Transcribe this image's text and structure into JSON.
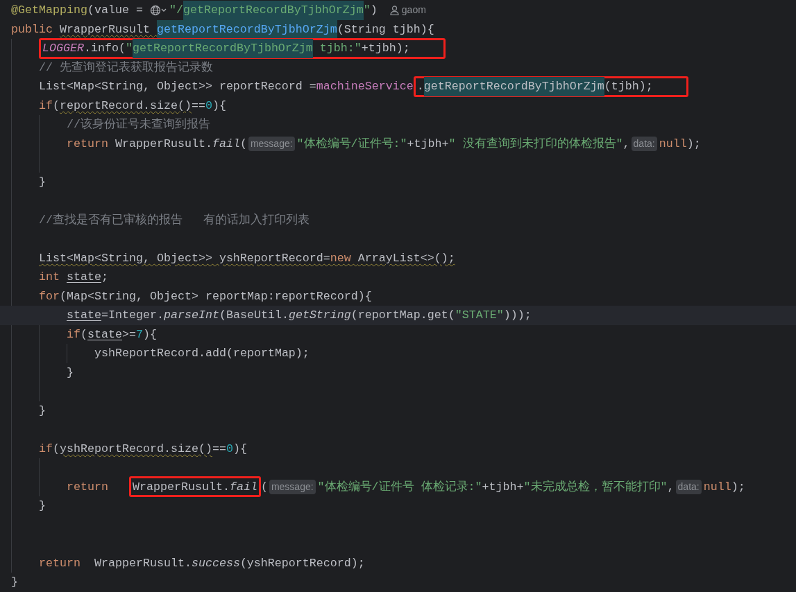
{
  "editor": {
    "lines": [
      {
        "tokens": [
          {
            "kind": "ann",
            "text": "@GetMapping"
          },
          {
            "kind": "plain",
            "text": "(value = "
          },
          {
            "kind": "globe"
          },
          {
            "kind": "str",
            "text": "\"/"
          },
          {
            "kind": "str",
            "text": "getReportRecordByTjbhOrZjm",
            "highlight": true
          },
          {
            "kind": "str",
            "text": "\""
          },
          {
            "kind": "plain",
            "text": ")"
          },
          {
            "kind": "author",
            "text": "gaom"
          }
        ]
      },
      {
        "tokens": [
          {
            "kind": "kw",
            "text": "public "
          },
          {
            "kind": "plain",
            "text": "WrapperRusult ",
            "warning": true
          },
          {
            "kind": "decl",
            "text": "getReportRecordByTjbhOrZjm",
            "highlight": true
          },
          {
            "kind": "plain",
            "text": "(String tjbh){"
          }
        ],
        "children": [
          {
            "tokens": [
              {
                "kind": "callout",
                "tokens": [
                  {
                    "kind": "field",
                    "text": "LOGGER"
                  },
                  {
                    "kind": "plain",
                    "text": ".info("
                  },
                  {
                    "kind": "str",
                    "text": "\""
                  },
                  {
                    "kind": "str",
                    "text": "getReportRecordByTjbhOrZjm",
                    "highlight": true
                  },
                  {
                    "kind": "str",
                    "text": " tjbh:\""
                  },
                  {
                    "kind": "plain",
                    "text": "+tjbh);"
                  }
                ]
              }
            ]
          },
          {
            "tokens": [
              {
                "kind": "comment",
                "text": "// 先查询登记表获取报告记录数"
              }
            ]
          },
          {
            "tokens": [
              {
                "kind": "plain",
                "text": "List<Map<String, Object>> reportRecord ="
              },
              {
                "kind": "member",
                "text": "machineService"
              },
              {
                "kind": "callout",
                "tokens": [
                  {
                    "kind": "plain",
                    "text": "."
                  },
                  {
                    "kind": "plain",
                    "text": "getReportRecordByTjbhOrZjm",
                    "highlight": true
                  },
                  {
                    "kind": "plain",
                    "text": "(tjbh);"
                  }
                ]
              }
            ]
          },
          {
            "tokens": [
              {
                "kind": "kw",
                "text": "if"
              },
              {
                "kind": "plain",
                "text": "("
              },
              {
                "kind": "plain",
                "text": "reportRecord.size()",
                "warning": true
              },
              {
                "kind": "plain",
                "text": "=="
              },
              {
                "kind": "num",
                "text": "0"
              },
              {
                "kind": "plain",
                "text": "){"
              }
            ],
            "children": [
              {
                "tokens": [
                  {
                    "kind": "comment",
                    "text": "//该身份证号未查询到报告"
                  }
                ]
              },
              {
                "tokens": [
                  {
                    "kind": "kw",
                    "text": "return "
                  },
                  {
                    "kind": "plain",
                    "text": "WrapperRusult."
                  },
                  {
                    "kind": "static",
                    "text": "fail"
                  },
                  {
                    "kind": "plain",
                    "text": "("
                  },
                  {
                    "kind": "hint",
                    "text": "message:"
                  },
                  {
                    "kind": "str",
                    "text": "\"体检编号/证件号:\""
                  },
                  {
                    "kind": "plain",
                    "text": "+tjbh+"
                  },
                  {
                    "kind": "str",
                    "text": "\" 没有查询到未打印的体检报告\""
                  },
                  {
                    "kind": "plain",
                    "text": ","
                  },
                  {
                    "kind": "hint",
                    "text": "data:"
                  },
                  {
                    "kind": "kw",
                    "text": "null"
                  },
                  {
                    "kind": "plain",
                    "text": ");"
                  }
                ]
              },
              {
                "kind": "blank"
              }
            ]
          },
          {
            "tokens": [
              {
                "kind": "plain",
                "text": "}"
              }
            ]
          },
          {
            "kind": "blank"
          },
          {
            "tokens": [
              {
                "kind": "comment",
                "text": "//查找是否有已审核的报告   有的话加入打印列表"
              }
            ]
          },
          {
            "kind": "blank"
          },
          {
            "tokens": [
              {
                "kind": "plain",
                "text": "List<Map<String, Object>> yshReportRecord=",
                "warning": true
              },
              {
                "kind": "kw",
                "text": "new ",
                "warning": true
              },
              {
                "kind": "plain",
                "text": "ArrayList<>();",
                "warning": true
              }
            ]
          },
          {
            "tokens": [
              {
                "kind": "kw",
                "text": "int "
              },
              {
                "kind": "plain",
                "text": "state",
                "reassigned": true
              },
              {
                "kind": "plain",
                "text": ";"
              }
            ]
          },
          {
            "tokens": [
              {
                "kind": "kw",
                "text": "for"
              },
              {
                "kind": "plain",
                "text": "(Map<String, Object> reportMap:reportRecord){"
              }
            ],
            "children": [
              {
                "current": true,
                "tokens": [
                  {
                    "kind": "plain",
                    "text": "state",
                    "reassigned": true
                  },
                  {
                    "kind": "plain",
                    "text": "=Integer."
                  },
                  {
                    "kind": "static",
                    "text": "parseInt"
                  },
                  {
                    "kind": "plain",
                    "text": "(BaseUtil."
                  },
                  {
                    "kind": "static",
                    "text": "getString"
                  },
                  {
                    "kind": "plain",
                    "text": "(reportMap.get("
                  },
                  {
                    "kind": "str",
                    "text": "\"STATE\""
                  },
                  {
                    "kind": "plain",
                    "text": ")));"
                  }
                ]
              },
              {
                "tokens": [
                  {
                    "kind": "kw",
                    "text": "if"
                  },
                  {
                    "kind": "plain",
                    "text": "("
                  },
                  {
                    "kind": "plain",
                    "text": "state",
                    "reassigned": true
                  },
                  {
                    "kind": "plain",
                    "text": ">="
                  },
                  {
                    "kind": "num",
                    "text": "7"
                  },
                  {
                    "kind": "plain",
                    "text": "){"
                  }
                ],
                "children": [
                  {
                    "tokens": [
                      {
                        "kind": "plain",
                        "text": "yshReportRecord.add(reportMap);"
                      }
                    ]
                  }
                ]
              },
              {
                "tokens": [
                  {
                    "kind": "plain",
                    "text": "}"
                  }
                ]
              },
              {
                "kind": "blank"
              }
            ]
          },
          {
            "tokens": [
              {
                "kind": "plain",
                "text": "}"
              }
            ]
          },
          {
            "kind": "blank"
          },
          {
            "tokens": [
              {
                "kind": "kw",
                "text": "if"
              },
              {
                "kind": "plain",
                "text": "("
              },
              {
                "kind": "plain",
                "text": "yshReportRecord.size()",
                "warning": true
              },
              {
                "kind": "plain",
                "text": "=="
              },
              {
                "kind": "num",
                "text": "0"
              },
              {
                "kind": "plain",
                "text": "){"
              }
            ],
            "children": [
              {
                "kind": "blank"
              },
              {
                "tokens": [
                  {
                    "kind": "kw",
                    "text": "return   "
                  },
                  {
                    "kind": "callout",
                    "tokens": [
                      {
                        "kind": "plain",
                        "text": "WrapperRusult."
                      },
                      {
                        "kind": "static",
                        "text": "fail"
                      }
                    ]
                  },
                  {
                    "kind": "plain",
                    "text": "("
                  },
                  {
                    "kind": "hint",
                    "text": "message:"
                  },
                  {
                    "kind": "str",
                    "text": "\"体检编号/证件号 体检记录:\""
                  },
                  {
                    "kind": "plain",
                    "text": "+tjbh+"
                  },
                  {
                    "kind": "str",
                    "text": "\"未完成总检，暂不能打印\""
                  },
                  {
                    "kind": "plain",
                    "text": ","
                  },
                  {
                    "kind": "hint",
                    "text": "data:"
                  },
                  {
                    "kind": "kw",
                    "text": "null"
                  },
                  {
                    "kind": "plain",
                    "text": ");"
                  }
                ]
              }
            ]
          },
          {
            "tokens": [
              {
                "kind": "plain",
                "text": "}"
              }
            ]
          },
          {
            "kind": "blank"
          },
          {
            "kind": "blank"
          },
          {
            "tokens": [
              {
                "kind": "kw",
                "text": "return  "
              },
              {
                "kind": "plain",
                "text": "WrapperRusult."
              },
              {
                "kind": "static",
                "text": "success"
              },
              {
                "kind": "plain",
                "text": "(yshReportRecord);"
              }
            ]
          }
        ]
      },
      {
        "tokens": [
          {
            "kind": "plain",
            "text": "}"
          }
        ]
      }
    ]
  }
}
